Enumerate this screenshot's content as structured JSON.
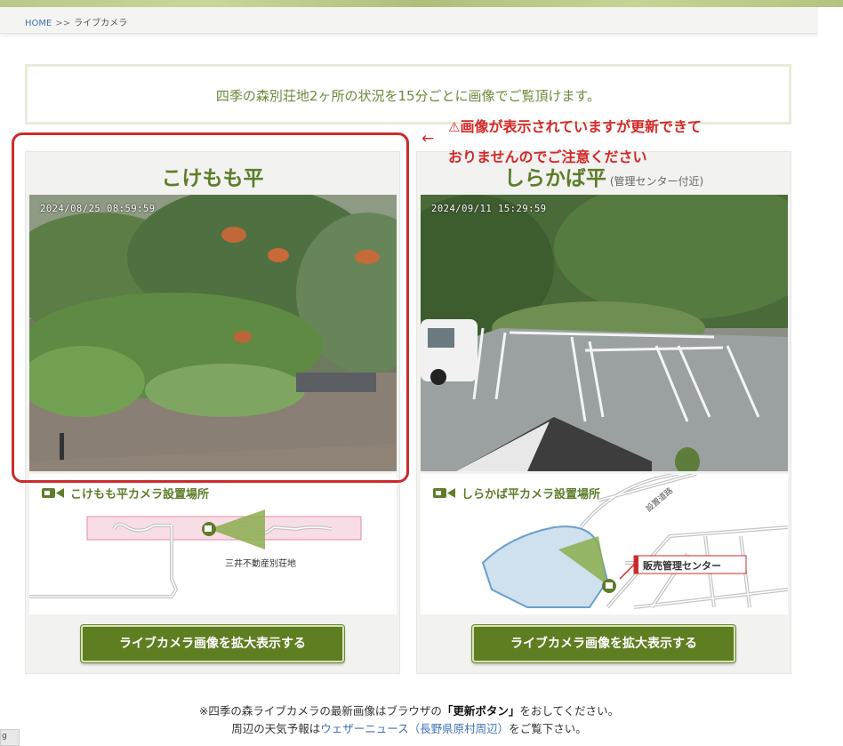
{
  "breadcrumb": {
    "home": "HOME",
    "separator": ">>",
    "current": "ライブカメラ"
  },
  "intro": "四季の森別荘地2ヶ所の状況を15分ごとに画像でご覧頂けます。",
  "warning": {
    "icon": "⚠",
    "line1": "画像が表示されていますが更新できて",
    "line2": "おりませんのでご注意ください",
    "arrow": "←",
    "color": "#d42828"
  },
  "cameras": {
    "left": {
      "title": "こけもも平",
      "timestamp": "2024/08/25  08:59:59",
      "map_title": "こけもも平カメラ設置場所",
      "map_label": "三井不動産別荘地",
      "button": "ライブカメラ画像を拡大表示する"
    },
    "right": {
      "title": "しらかば平",
      "subtitle": "(管理センター付近)",
      "timestamp": "2024/09/11  15:29:59",
      "map_title": "しらかば平カメラ設置場所",
      "map_road": "設置道路",
      "map_label": "販売管理センター",
      "button": "ライブカメラ画像を拡大表示する"
    }
  },
  "footer": {
    "line1_pre": "※四季の森ライブカメラの最新画像はブラウザの",
    "line1_bold": "「更新ボタン」",
    "line1_post": "をおしてください。",
    "line2_pre": "周辺の天気予報は",
    "line2_link": "ウェザーニュース（長野県原村周辺）",
    "line2_post": "をご覧下さい。"
  },
  "corner_text": "g",
  "colors": {
    "accent_green": "#5e7d2b",
    "button_green": "#5f7e22",
    "highlight_red": "#cc2b2b",
    "link_blue": "#3f72b8"
  }
}
